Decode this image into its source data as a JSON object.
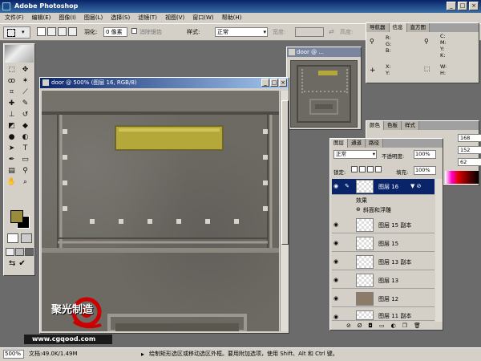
{
  "app": {
    "title": "Adobe Photoshop"
  },
  "menu": [
    "文件(F)",
    "编辑(E)",
    "图像(I)",
    "图层(L)",
    "选择(S)",
    "滤镜(T)",
    "视图(V)",
    "窗口(W)",
    "帮助(H)"
  ],
  "options": {
    "feather_label": "羽化:",
    "feather_value": "0 像素",
    "antialias_label": "消除锯齿",
    "style_label": "样式:",
    "style_value": "正常",
    "width_label": "宽度:",
    "height_label": "高度:"
  },
  "document": {
    "title": "door @ 500% (图层 16, RGB/8)"
  },
  "navigator": {
    "title": "door @ ..."
  },
  "info": {
    "tabs": [
      "导航器",
      "信息",
      "直方图"
    ],
    "labels_left": [
      "R:",
      "G:",
      "B:"
    ],
    "labels_right": [
      "C:",
      "M:",
      "Y:",
      "K:"
    ],
    "xy": [
      "X:",
      "Y:"
    ],
    "wh": [
      "W:",
      "H:"
    ]
  },
  "color": {
    "tabs": [
      "颜色",
      "色板",
      "样式"
    ],
    "values": [
      "168",
      "152",
      "62"
    ]
  },
  "layers": {
    "tabs": [
      "图层",
      "通道",
      "路径"
    ],
    "blend_mode": "正常",
    "opacity_label": "不透明度:",
    "opacity_value": "100%",
    "lock_label": "锁定:",
    "fill_label": "填充:",
    "fill_value": "100%",
    "active_layer": "图层 16",
    "effects_label": "效果",
    "effect_name": "斜面和浮雕",
    "items": [
      "图层 15 副本",
      "图层 15",
      "图层 13 副本",
      "图层 13",
      "图层 12",
      "图层 11 副本"
    ]
  },
  "status": {
    "zoom": "500%",
    "doc_size": "文档:49.0K/1.49M",
    "hint": "绘制矩形选区或移动选区外框。要用附加选项，使用 Shift、Alt 和 Ctrl 键。"
  },
  "watermark": {
    "name": "聚光制造",
    "url": "www.cgqood.com"
  },
  "colors": {
    "foreground": "#9a8c3a",
    "background": "#000000",
    "plaque": "#b5a83a",
    "titlebar": "#0a246a"
  }
}
